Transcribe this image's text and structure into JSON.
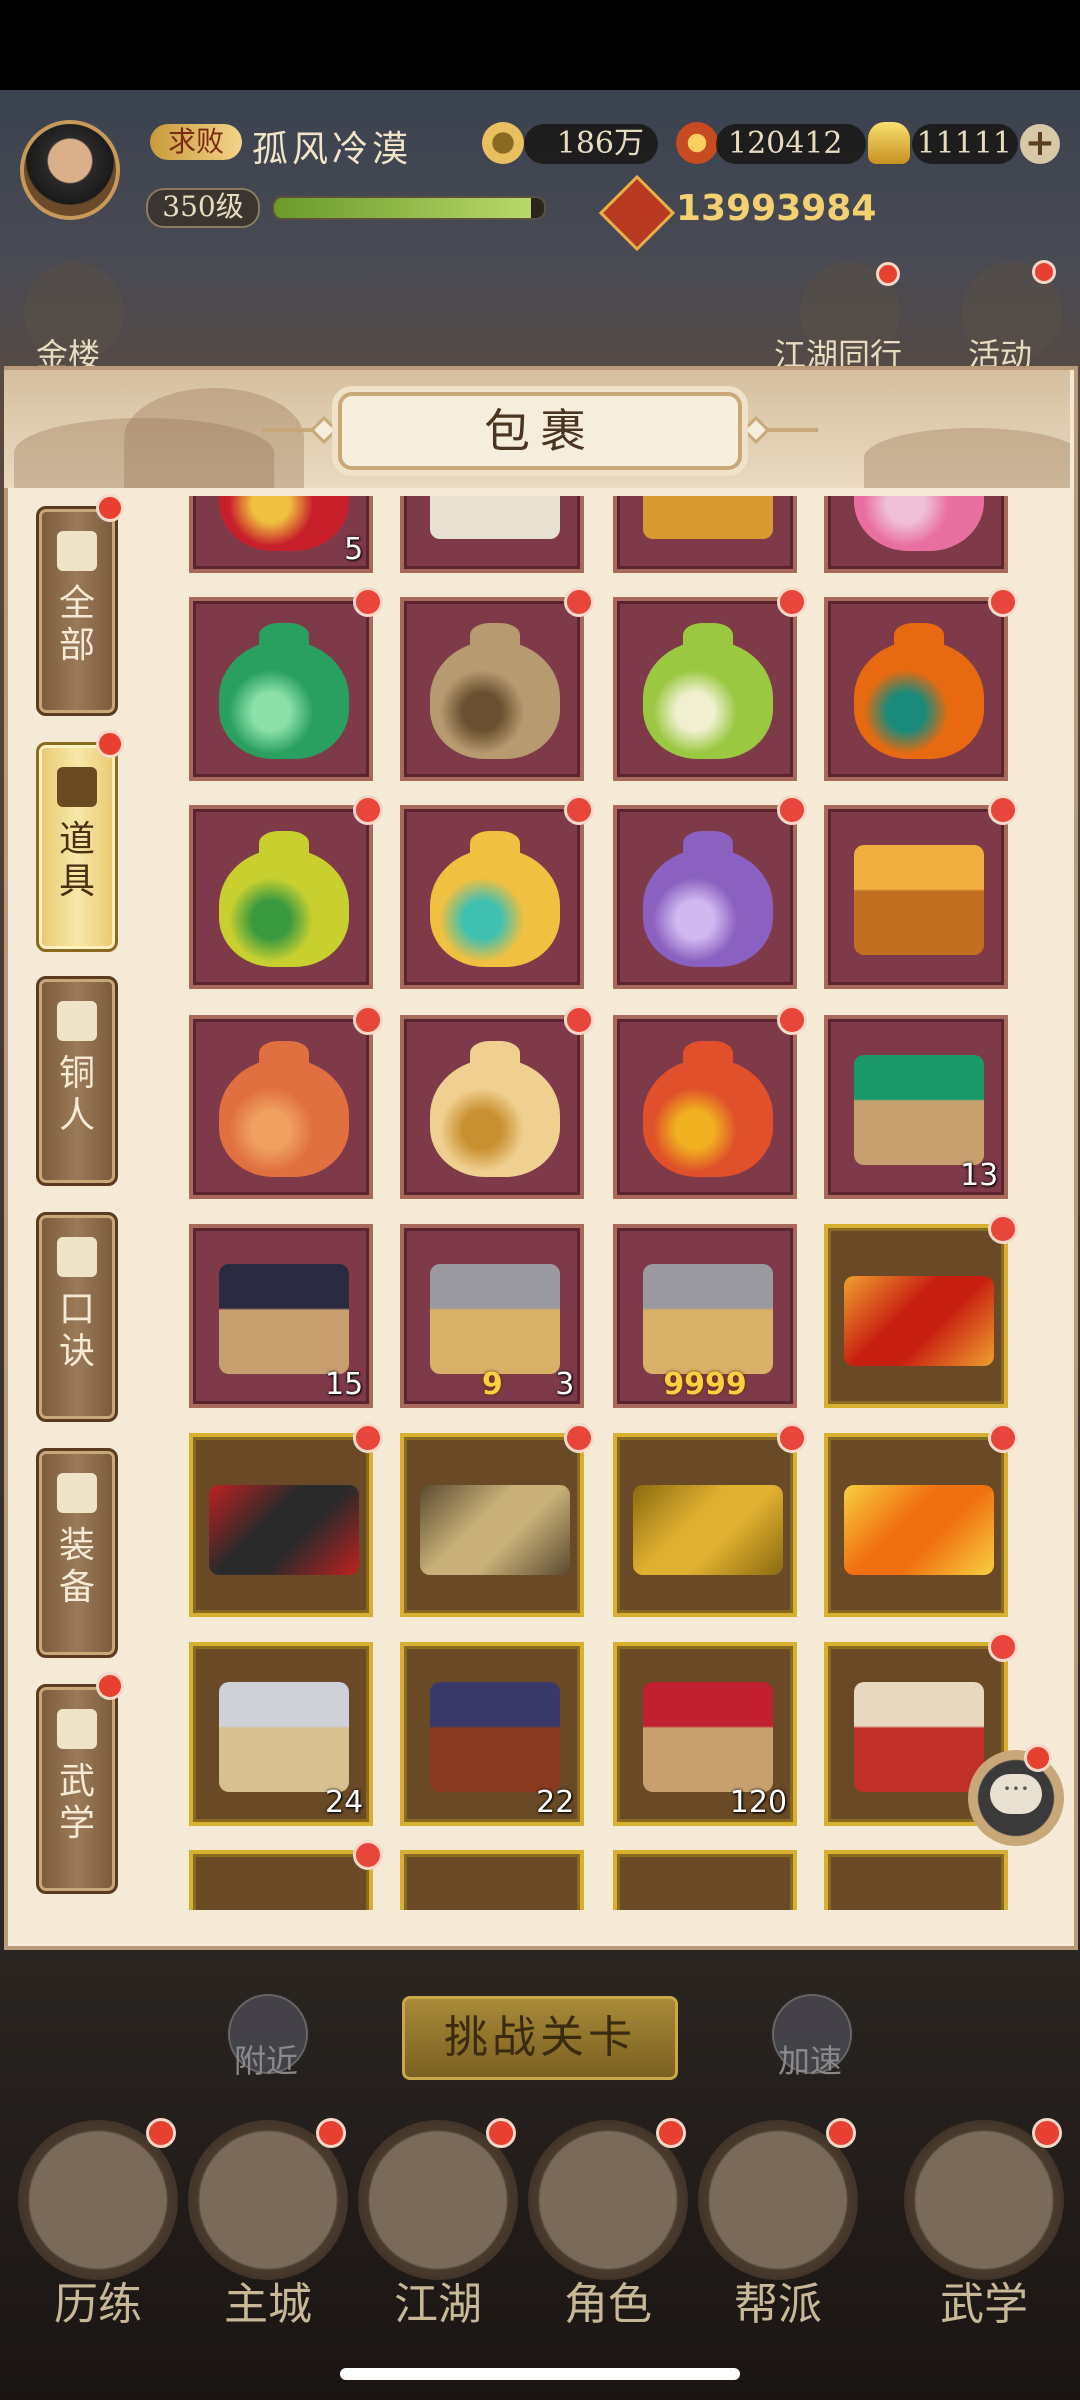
{
  "header": {
    "rank_badge": "求败",
    "player_name": "孤风冷漠",
    "level": "350级",
    "exp_progress": 0.95,
    "currencies": [
      {
        "name": "coin-icon",
        "value": "186万"
      },
      {
        "name": "lantern-icon",
        "value": "120412"
      },
      {
        "name": "gold-ingot-icon",
        "value": "11111"
      }
    ],
    "power": "13993984"
  },
  "top_menu": {
    "left_label": "金楼",
    "mid_label": "江湖同行",
    "right_label": "活动"
  },
  "panel": {
    "title": "包裹",
    "tabs": [
      {
        "label": "全\n部",
        "icon": "fan-icon",
        "active": false,
        "badge": true
      },
      {
        "label": "道\n具",
        "icon": "pouch-icon",
        "active": true,
        "badge": true
      },
      {
        "label": "铜\n人",
        "icon": "bronze-figure-icon",
        "active": false,
        "badge": false
      },
      {
        "label": "口\n诀",
        "icon": "scroll-icon",
        "active": false,
        "badge": false
      },
      {
        "label": "装\n备",
        "icon": "armor-icon",
        "active": false,
        "badge": false
      },
      {
        "label": "武\n学",
        "icon": "book-icon",
        "active": false,
        "badge": true
      }
    ],
    "items": [
      {
        "icon": "red-gift-bag-icon",
        "qty": "5",
        "badge": false,
        "style": "red"
      },
      {
        "icon": "notice-scroll-icon",
        "qty": "",
        "badge": false,
        "style": "red"
      },
      {
        "icon": "gold-lantern-box-icon",
        "qty": "",
        "badge": false,
        "style": "red"
      },
      {
        "icon": "pink-flower-bag-icon",
        "qty": "",
        "badge": false,
        "style": "red"
      },
      {
        "icon": "green-pouch-icon",
        "qty": "",
        "badge": true,
        "style": "red"
      },
      {
        "icon": "burlap-sack-icon",
        "qty": "",
        "badge": true,
        "style": "red"
      },
      {
        "icon": "lily-pouch-icon",
        "qty": "",
        "badge": true,
        "style": "red"
      },
      {
        "icon": "orange-pouch-icon",
        "qty": "",
        "badge": true,
        "style": "red"
      },
      {
        "icon": "yellow-green-pouch-icon",
        "qty": "",
        "badge": true,
        "style": "red"
      },
      {
        "icon": "rainbow-pouch-icon",
        "qty": "",
        "badge": true,
        "style": "red"
      },
      {
        "icon": "purple-pouch-icon",
        "qty": "",
        "badge": true,
        "style": "red"
      },
      {
        "icon": "treasure-chest-icon",
        "qty": "",
        "badge": true,
        "style": "red"
      },
      {
        "icon": "maple-pouch-icon",
        "qty": "",
        "badge": true,
        "style": "red"
      },
      {
        "icon": "chrysanthemum-pouch-icon",
        "qty": "",
        "badge": true,
        "style": "red"
      },
      {
        "icon": "red-gold-pouch-icon",
        "qty": "",
        "badge": true,
        "style": "red"
      },
      {
        "icon": "jade-tray-icon",
        "qty": "13",
        "badge": false,
        "style": "red"
      },
      {
        "icon": "gem-tray-icon",
        "qty": "15",
        "badge": false,
        "style": "red"
      },
      {
        "icon": "weapon-crate-icon",
        "qty": "3",
        "gold_qty": "9",
        "badge": false,
        "style": "red"
      },
      {
        "icon": "weapon-crate-icon",
        "qty": "",
        "gold_qty": "9999",
        "badge": false,
        "style": "red"
      },
      {
        "icon": "red-frame-icon",
        "qty": "",
        "badge": true,
        "style": "gold"
      },
      {
        "icon": "black-frame-icon",
        "qty": "",
        "badge": true,
        "style": "gold"
      },
      {
        "icon": "horse-frame-icon",
        "qty": "",
        "badge": true,
        "style": "gold"
      },
      {
        "icon": "gold-frame-icon",
        "qty": "",
        "badge": true,
        "style": "gold"
      },
      {
        "icon": "flame-frame-icon",
        "qty": "",
        "badge": true,
        "style": "gold"
      },
      {
        "icon": "coin-scroll-crate-icon",
        "qty": "24",
        "badge": false,
        "style": "gold"
      },
      {
        "icon": "ore-crate-icon",
        "qty": "22",
        "badge": false,
        "style": "gold"
      },
      {
        "icon": "book-crate-icon",
        "qty": "120",
        "badge": false,
        "style": "gold"
      },
      {
        "icon": "manual-book-icon",
        "qty": "",
        "badge": true,
        "style": "gold"
      },
      {
        "icon": "partial-item-icon",
        "qty": "",
        "badge": true,
        "style": "gold"
      },
      {
        "icon": "partial-item-icon",
        "qty": "",
        "badge": false,
        "style": "gold"
      },
      {
        "icon": "partial-item-icon",
        "qty": "",
        "badge": false,
        "style": "gold"
      },
      {
        "icon": "partial-item-icon",
        "qty": "",
        "badge": false,
        "style": "gold"
      }
    ]
  },
  "actions": {
    "nearby_label": "附近",
    "challenge_label": "挑战关卡",
    "speedup_label": "加速"
  },
  "bottom_nav": [
    {
      "label": "历练",
      "badge": true
    },
    {
      "label": "主城",
      "badge": true
    },
    {
      "label": "江湖",
      "badge": true
    },
    {
      "label": "角色",
      "badge": true
    },
    {
      "label": "帮派",
      "badge": true
    },
    {
      "label": "武学",
      "badge": true
    }
  ]
}
